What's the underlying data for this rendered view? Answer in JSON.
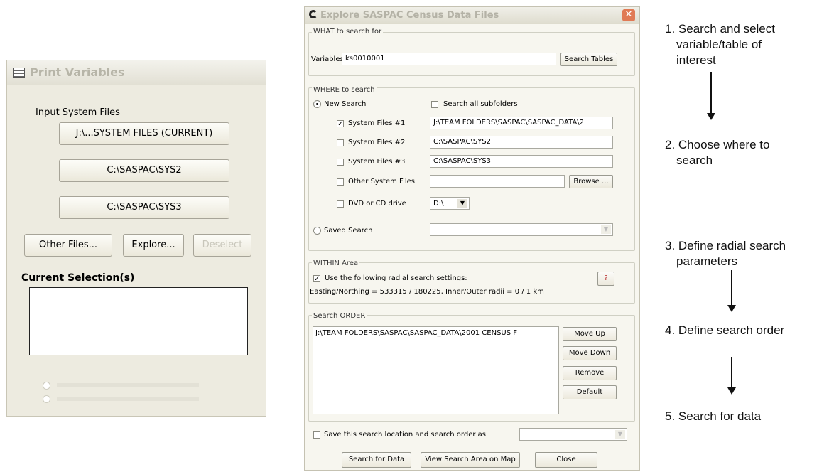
{
  "print_panel": {
    "title": "Print Variables",
    "input_label": "Input System Files",
    "file_buttons": [
      "J:\\...SYSTEM FILES (CURRENT)",
      "C:\\SASPAC\\SYS2",
      "C:\\SASPAC\\SYS3"
    ],
    "other_files": "Other Files...",
    "explore": "Explore...",
    "deselect": "Deselect",
    "current_selection_label": "Current Selection(s)"
  },
  "explore_dialog": {
    "title": "Explore SASPAC Census Data Files",
    "what": {
      "group_label": "WHAT to search for",
      "variables_label": "Variables",
      "variables_value": "ks0010001",
      "search_tables": "Search Tables"
    },
    "where": {
      "group_label": "WHERE to search",
      "new_search": "New Search",
      "search_all_subfolders": "Search all subfolders",
      "rows": [
        {
          "label": "System Files #1",
          "checked": true,
          "path": "J:\\TEAM FOLDERS\\SASPAC\\SASPAC_DATA\\2"
        },
        {
          "label": "System Files #2",
          "checked": false,
          "path": "C:\\SASPAC\\SYS2"
        },
        {
          "label": "System Files #3",
          "checked": false,
          "path": "C:\\SASPAC\\SYS3"
        },
        {
          "label": "Other System Files",
          "checked": false,
          "path": ""
        }
      ],
      "browse": "Browse ...",
      "dvd_label": "DVD or CD drive",
      "dvd_value": "D:\\",
      "saved_search": "Saved Search"
    },
    "within": {
      "group_label": "WITHIN Area",
      "use_radial": "Use the following radial search settings:",
      "help": "?",
      "easting_text": "Easting/Northing = 533315 / 180225, Inner/Outer radii = 0 / 1 km"
    },
    "order": {
      "group_label": "Search ORDER",
      "list_item": "J:\\TEAM FOLDERS\\SASPAC\\SASPAC_DATA\\2001 CENSUS F",
      "move_up": "Move Up",
      "move_down": "Move Down",
      "remove": "Remove",
      "default": "Default"
    },
    "save_label": "Save this search location and search order as",
    "search_for_data": "Search for Data",
    "view_map": "View Search Area on Map",
    "close": "Close"
  },
  "steps": [
    {
      "line1": "1. Search and select",
      "line2": "variable/table of",
      "line3": "interest"
    },
    {
      "line1": "2. Choose where to",
      "line2": "search"
    },
    {
      "line1": "3. Define radial search",
      "line2": "parameters"
    },
    {
      "line1": "4. Define search order"
    },
    {
      "line1": "5. Search for data"
    }
  ]
}
